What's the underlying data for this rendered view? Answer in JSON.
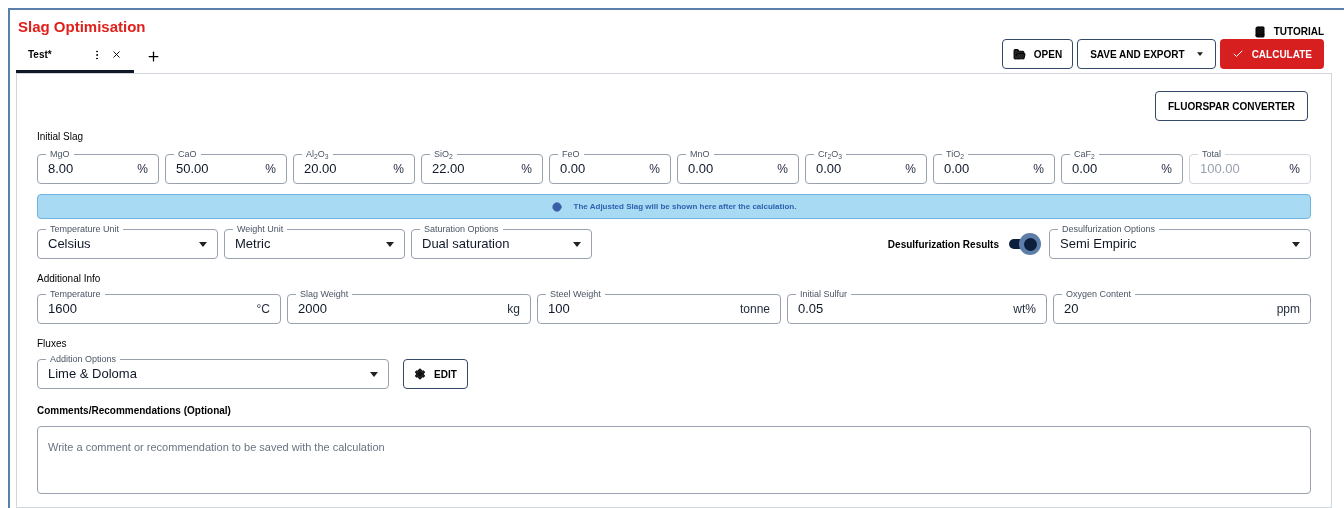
{
  "title": "Slag Optimisation",
  "tutorial": "TUTORIAL",
  "tabs": [
    {
      "label": "Test*",
      "selected": true
    }
  ],
  "toolbar": {
    "open": "OPEN",
    "save_export": "SAVE AND EXPORT",
    "calculate": "CALCULATE"
  },
  "fluorspar_button": "FLUORSPAR CONVERTER",
  "initial_slag": {
    "heading": "Initial Slag",
    "fields": [
      {
        "label": "MgO",
        "value": "8.00",
        "unit": "%",
        "disabled": false
      },
      {
        "label": "CaO",
        "value": "50.00",
        "unit": "%",
        "disabled": false
      },
      {
        "label": "Al$_{2}$O$_{3}$",
        "value": "20.00",
        "unit": "%",
        "disabled": false
      },
      {
        "label": "SiO$_{2}$",
        "value": "22.00",
        "unit": "%",
        "disabled": false
      },
      {
        "label": "FeO",
        "value": "0.00",
        "unit": "%",
        "disabled": false
      },
      {
        "label": "MnO",
        "value": "0.00",
        "unit": "%",
        "disabled": false
      },
      {
        "label": "Cr$_{2}$O$_{3}$",
        "value": "0.00",
        "unit": "%",
        "disabled": false
      },
      {
        "label": "TiO$_{2}$",
        "value": "0.00",
        "unit": "%",
        "disabled": false
      },
      {
        "label": "CaF$_{2}$",
        "value": "0.00",
        "unit": "%",
        "disabled": false
      },
      {
        "label": "Total",
        "value": "100.00",
        "unit": "%",
        "disabled": true
      }
    ]
  },
  "info_message": "The Adjusted Slag will be shown here after the calculation.",
  "options": [
    {
      "label": "Temperature Unit",
      "value": "Celsius"
    },
    {
      "label": "Weight Unit",
      "value": "Metric"
    },
    {
      "label": "Saturation Options",
      "value": "Dual saturation"
    }
  ],
  "desulfurization": {
    "label": "Desulfurization Results",
    "on": true,
    "select": {
      "label": "Desulfurization Options",
      "value": "Semi Empiric"
    }
  },
  "additional_info": {
    "heading": "Additional Info",
    "fields": [
      {
        "label": "Temperature",
        "value": "1600",
        "unit": "°C"
      },
      {
        "label": "Slag Weight",
        "value": "2000",
        "unit": "kg"
      },
      {
        "label": "Steel Weight",
        "value": "100",
        "unit": "tonne"
      },
      {
        "label": "Initial Sulfur",
        "value": "0.05",
        "unit": "wt%"
      },
      {
        "label": "Oxygen Content",
        "value": "20",
        "unit": "ppm"
      }
    ]
  },
  "fluxes": {
    "heading": "Fluxes",
    "select": {
      "label": "Addition Options",
      "value": "Lime & Doloma"
    },
    "edit_button": "EDIT"
  },
  "comments": {
    "heading": "Comments/Recommendations (Optional)",
    "placeholder": "Write a comment or recommendation to be saved with the calculation"
  }
}
